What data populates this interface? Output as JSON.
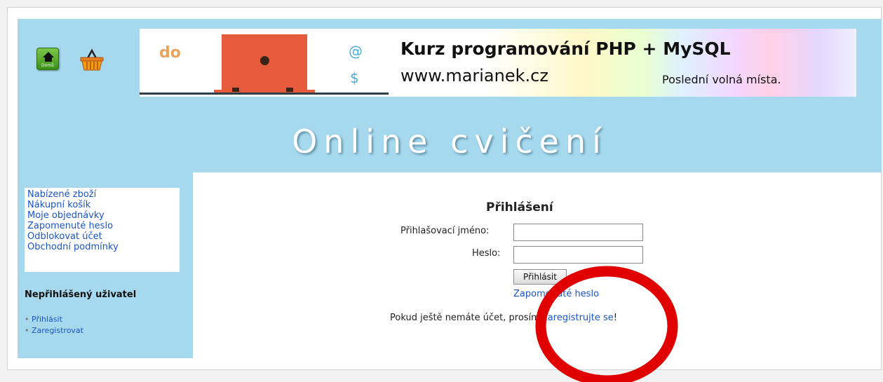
{
  "header": {
    "home_icon_label": "Domů",
    "banner": {
      "do_text": "do",
      "at_symbol": "@",
      "dollar_symbol": "$",
      "title": "Kurz programování PHP + MySQL",
      "url": "www.marianek.cz",
      "seats": "Poslední volná místa."
    },
    "site_title": "Online cvičení"
  },
  "sidebar": {
    "menu": [
      "Nabízené zboží",
      "Nákupní košík",
      "Moje objednávky",
      "Zapomenuté heslo",
      "Odblokovat účet",
      "Obchodní podmínky"
    ],
    "user_heading": "Nepřihlášený uživatel",
    "user_links": [
      "Přihlásit",
      "Zaregistrovat"
    ]
  },
  "login": {
    "title": "Přihlášení",
    "username_label": "Přihlašovací jméno:",
    "username_value": "",
    "password_label": "Heslo:",
    "password_value": "",
    "submit_label": "Přihlásit",
    "forgot_link": "Zapomenuté heslo",
    "register_text": "Pokud ještě nemáte účet, prosím ",
    "register_link": "zaregistrujte se",
    "register_suffix": "!"
  },
  "colors": {
    "header_bg": "#a6d9ee",
    "link": "#1a55c8",
    "annotation": "#e00000"
  }
}
